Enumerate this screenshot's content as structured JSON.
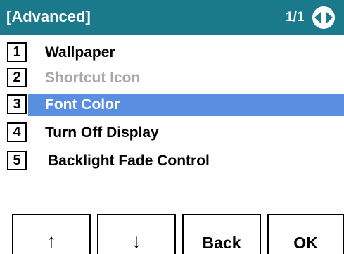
{
  "header": {
    "title": "[Advanced]",
    "page_indicator": "1/1",
    "bg_color": "#1a7a8c",
    "nav_icon": "left-right-arrows-icon"
  },
  "menu": {
    "items": [
      {
        "number": "1",
        "label": "Wallpaper",
        "state": "normal"
      },
      {
        "number": "2",
        "label": "Shortcut Icon",
        "state": "disabled"
      },
      {
        "number": "3",
        "label": "Font Color",
        "state": "selected"
      },
      {
        "number": "4",
        "label": "Turn Off Display",
        "state": "normal"
      },
      {
        "number": "5",
        "label": "Backlight Fade Control",
        "state": "normal"
      }
    ],
    "selected_color": "#5a8ee0",
    "disabled_color": "#a8a8a8"
  },
  "softkeys": [
    {
      "label": "↑",
      "icon": "up-arrow-icon"
    },
    {
      "label": "↓",
      "icon": "down-arrow-icon"
    },
    {
      "label": "Back"
    },
    {
      "label": "OK"
    }
  ]
}
